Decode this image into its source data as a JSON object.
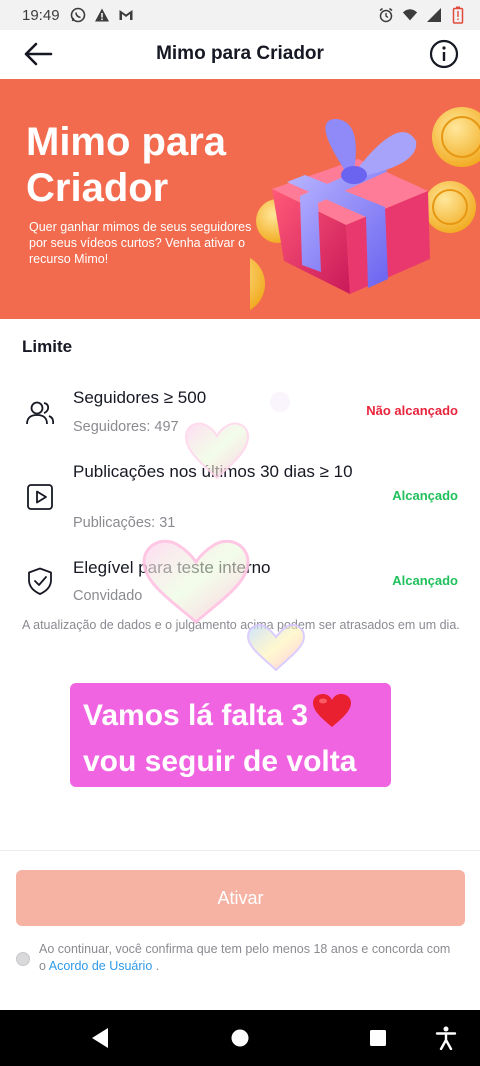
{
  "status_bar": {
    "time": "19:49",
    "icons_left": [
      "whatsapp-icon",
      "warning-icon",
      "gmail-icon"
    ],
    "icons_right": [
      "alarm-icon",
      "wifi-icon",
      "signal-icon",
      "battery-low-icon"
    ]
  },
  "header": {
    "title": "Mimo para Criador",
    "back_icon": "arrow-left-icon",
    "info_icon": "info-icon"
  },
  "banner": {
    "title": "Mimo para Criador",
    "subtitle": "Quer ganhar mimos de seus seguidores por seus vídeos curtos? Venha ativar o recurso Mimo!",
    "background_color": "#f26b4e"
  },
  "requirements": {
    "section_title": "Limite",
    "items": [
      {
        "icon": "followers-icon",
        "name": "Seguidores ≥ 500",
        "detail": "Seguidores: 497",
        "status": "Não alcançado",
        "met": false
      },
      {
        "icon": "video-icon",
        "name": "Publicações nos últimos 30 dias ≥ 10",
        "detail": "Publicações: 31",
        "status": "Alcançado",
        "met": true
      },
      {
        "icon": "shield-check-icon",
        "name": "Elegível para teste interno",
        "detail": "Convidado",
        "status": "Alcançado",
        "met": true
      }
    ],
    "note": "A atualização de dados e o julgamento acima podem ser atrasados em um dia."
  },
  "sticker": {
    "line1": "Vamos lá falta 3",
    "line2": "vou seguir de volta",
    "emoji": "❤️"
  },
  "action": {
    "button_label": "Ativar"
  },
  "consent": {
    "text_before": "Ao continuar, você confirma que tem pelo menos 18 anos e concorda com o ",
    "link": "Acordo de Usuário",
    "text_after": " ."
  },
  "colors": {
    "accent": "#f26b4e",
    "not_met": "#e8243c",
    "met": "#20c05c",
    "button_disabled": "#f6b3a4",
    "link": "#2f9ae8"
  }
}
